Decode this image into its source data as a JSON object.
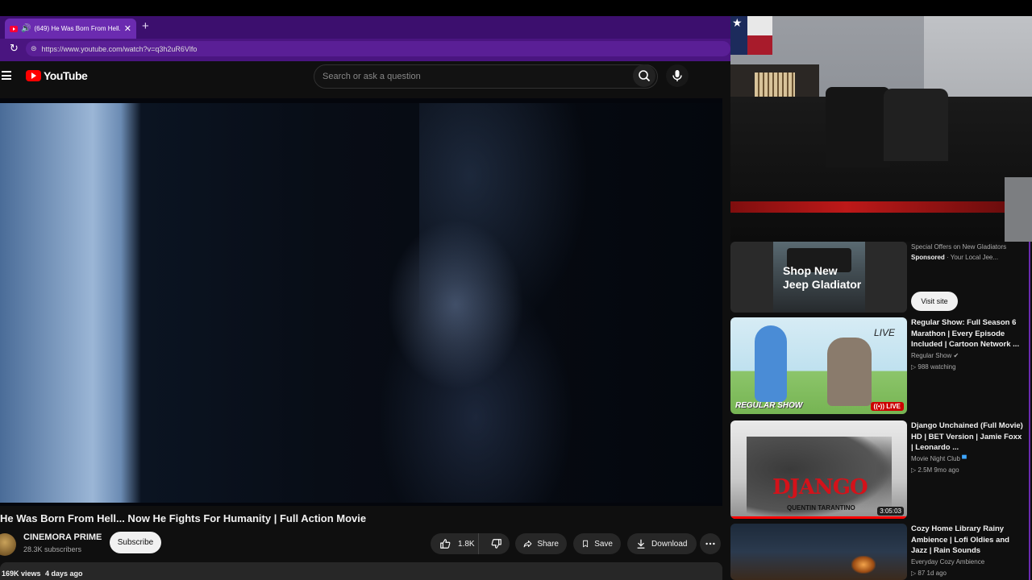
{
  "browser": {
    "tab_title": "(649) He Was Born From Hell...",
    "url": "https://www.youtube.com/watch?v=q3h2uR6Vlfo"
  },
  "youtube": {
    "logo_text": "YouTube",
    "search_placeholder": "Search or ask a question"
  },
  "video": {
    "title": "He Was Born From Hell... Now He Fights For Humanity | Full Action Movie",
    "channel_name": "CINEMORA PRIME",
    "subscribers": "28.3K subscribers",
    "subscribe_label": "Subscribe",
    "likes": "1.8K",
    "share_label": "Share",
    "save_label": "Save",
    "download_label": "Download",
    "views": "169K views",
    "posted": "4 days ago"
  },
  "sidebar": {
    "ad": {
      "thumb_text": "Shop New Jeep Gladiator",
      "title": "Special Offers on New Gladiators",
      "sponsored_label": "Sponsored",
      "advertiser": "Your Local Jee...",
      "cta": "Visit site"
    },
    "items": [
      {
        "title": "Regular Show: Full Season 6 Marathon | Every Episode Included | Cartoon Network ...",
        "channel": "Regular Show",
        "stats": "988 watching",
        "badge": "LIVE",
        "thumb_text": "LIVE",
        "thumb_logo": "REGULAR SHOW"
      },
      {
        "title": "Django Unchained (Full Movie) HD | BET Version | Jamie Foxx | Leonardo ...",
        "channel": "Movie Night Club",
        "stats": "2.5M",
        "age": "9mo ago",
        "duration": "3:05:03",
        "thumb_title": "DJANGO",
        "thumb_sub": "QUENTIN TARANTINO"
      },
      {
        "title": "Cozy Home Library Rainy Ambience | Lofi Oldies and Jazz | Rain Sounds",
        "channel": "Everyday Cozy Ambience",
        "stats": "87",
        "age": "1d ago"
      }
    ]
  },
  "colors": {
    "browser_frame": "#4a1580",
    "yt_bg": "#0f0f0f",
    "yt_red": "#ff0000"
  }
}
